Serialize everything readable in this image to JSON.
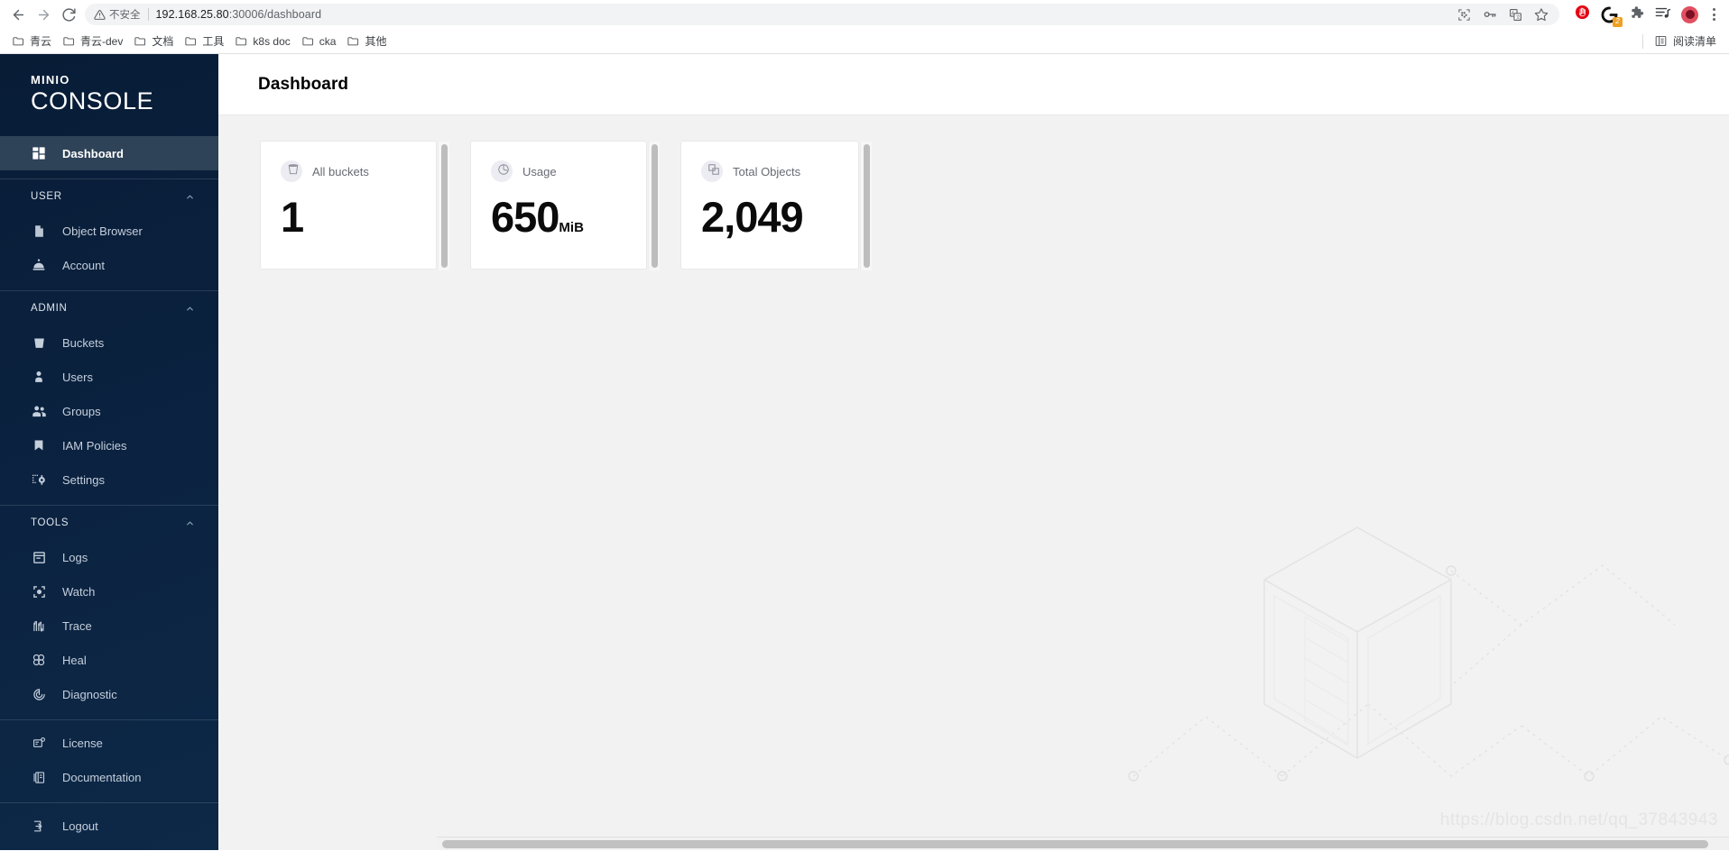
{
  "browser": {
    "nav": {
      "back_label": "Back",
      "forward_label": "Forward",
      "reload_label": "Reload"
    },
    "omnibox": {
      "security_warning": "不安全",
      "url_host": "192.168.25.80",
      "url_path": ":30006/dashboard",
      "full_url": "192.168.25.80:30006/dashboard"
    },
    "omnibox_icons": [
      "qr-code-icon",
      "key-icon",
      "translate-icon",
      "star-icon"
    ],
    "extension_icons": [
      "adblock-icon",
      "grammarly-icon",
      "puzzle-extensions-icon",
      "playlist-icon"
    ],
    "extension_badge_count": "2",
    "profile_label": "Profile",
    "menu_label": "Chrome menu",
    "bookmarks": [
      {
        "label": "青云"
      },
      {
        "label": "青云-dev"
      },
      {
        "label": "文档"
      },
      {
        "label": "工具"
      },
      {
        "label": "k8s doc"
      },
      {
        "label": "cka"
      },
      {
        "label": "其他"
      }
    ],
    "reading_list_label": "阅读清单"
  },
  "sidebar": {
    "logo_top": "MINIO",
    "logo_bottom": "CONSOLE",
    "top_items": [
      {
        "label": "Dashboard",
        "icon": "dashboard-grid-icon",
        "active": true
      }
    ],
    "sections": [
      {
        "title": "USER",
        "items": [
          {
            "label": "Object Browser",
            "icon": "document-icon"
          },
          {
            "label": "Account",
            "icon": "service-bell-icon"
          }
        ]
      },
      {
        "title": "ADMIN",
        "items": [
          {
            "label": "Buckets",
            "icon": "bucket-icon"
          },
          {
            "label": "Users",
            "icon": "user-icon"
          },
          {
            "label": "Groups",
            "icon": "groups-icon"
          },
          {
            "label": "IAM Policies",
            "icon": "bookmark-icon"
          },
          {
            "label": "Settings",
            "icon": "settings-gear-icon"
          }
        ]
      },
      {
        "title": "TOOLS",
        "items": [
          {
            "label": "Logs",
            "icon": "logs-window-icon"
          },
          {
            "label": "Watch",
            "icon": "watch-target-icon"
          },
          {
            "label": "Trace",
            "icon": "trace-waves-icon"
          },
          {
            "label": "Heal",
            "icon": "heal-knot-icon"
          },
          {
            "label": "Diagnostic",
            "icon": "diagnostic-pulse-icon"
          }
        ]
      }
    ],
    "footer_items": [
      {
        "label": "License",
        "icon": "license-icon"
      },
      {
        "label": "Documentation",
        "icon": "documentation-book-icon"
      }
    ],
    "logout": {
      "label": "Logout",
      "icon": "logout-arrow-icon"
    }
  },
  "page": {
    "title": "Dashboard"
  },
  "cards": [
    {
      "label": "All buckets",
      "icon": "bucket-icon",
      "value": "1",
      "unit": ""
    },
    {
      "label": "Usage",
      "icon": "pie-chart-icon",
      "value": "650",
      "unit": "MiB"
    },
    {
      "label": "Total Objects",
      "icon": "objects-stack-icon",
      "value": "2,049",
      "unit": ""
    }
  ],
  "watermark": {
    "url": "https://blog.csdn.net/qq_37843943",
    "illustration": "isometric-server-rack"
  }
}
